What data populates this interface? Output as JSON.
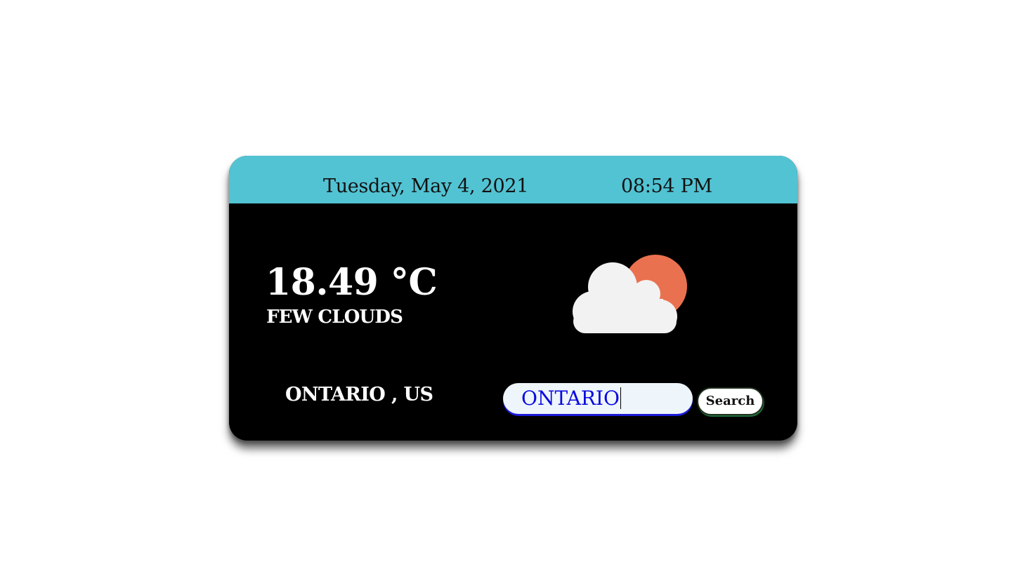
{
  "header": {
    "date": "Tuesday, May 4, 2021",
    "time": "08:54 PM"
  },
  "weather": {
    "temperature": "18.49 °C",
    "condition": "FEW CLOUDS",
    "location": "ONTARIO , US",
    "icon": "partly-cloudy-icon"
  },
  "search": {
    "value": "ONTARIO",
    "button_label": "Search"
  },
  "colors": {
    "header_bg": "#52c3d3",
    "card_bg": "#000000",
    "sun": "#ea7150",
    "cloud": "#f2f2f2",
    "input_text": "#0a0adf"
  }
}
